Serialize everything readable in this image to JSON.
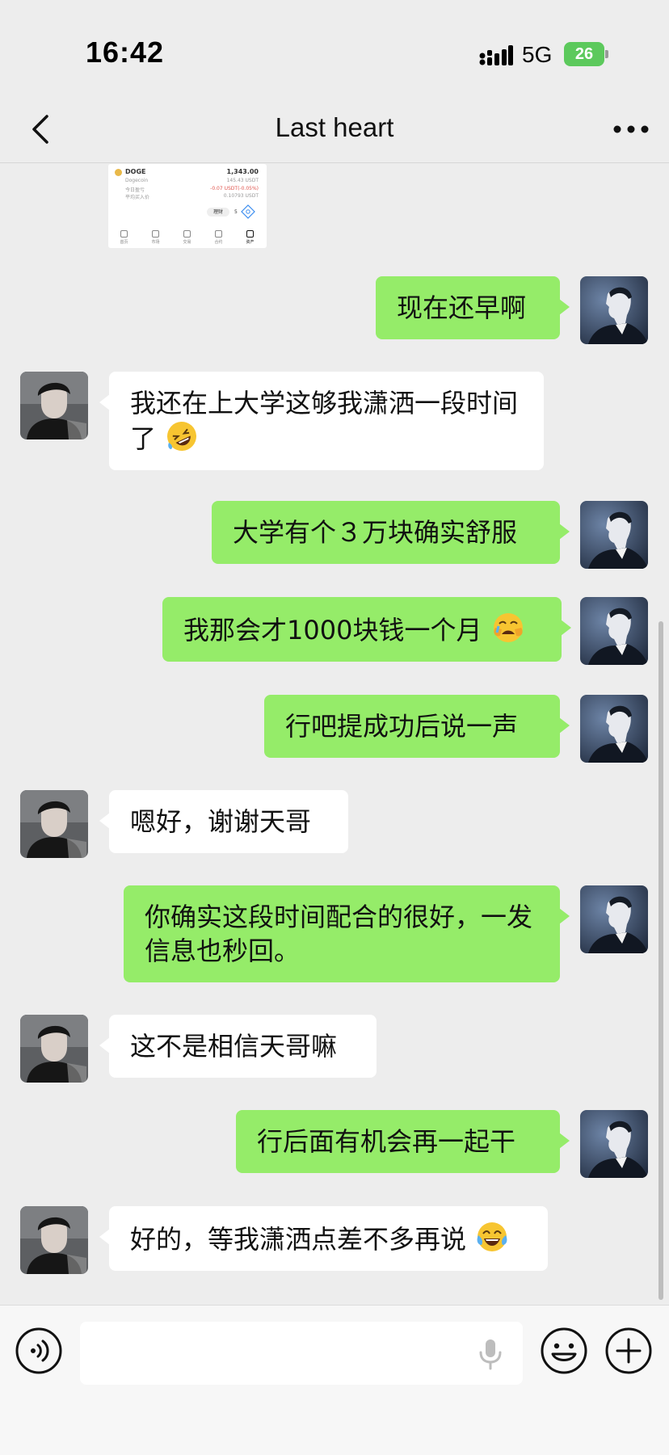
{
  "status_bar": {
    "time": "16:42",
    "network": "5G",
    "battery_level": "26",
    "battery_color": "#5cc95c"
  },
  "header": {
    "back_icon": "chevron-left-icon",
    "title": "Last heart",
    "more_icon": "more-icon"
  },
  "shared_image": {
    "coin": "DOGE",
    "coin_name": "Dogecoin",
    "amount": "1,343.00",
    "amount_usdt": "145.43 USDT",
    "pnl_label": "今日盈亏",
    "pnl_value": "-0.07 USDT(-0.05%)",
    "avg_label": "平均买入价",
    "avg_value": "0.10793 USDT",
    "action_label": "理财",
    "action_value": "5",
    "nav": [
      "首页",
      "市场",
      "交易",
      "合约",
      "资产"
    ]
  },
  "colors": {
    "sent_bubble": "#95ec69",
    "received_bubble": "#ffffff",
    "background": "#ededed"
  },
  "messages": [
    {
      "sender": "me",
      "text": "现在还早啊"
    },
    {
      "sender": "other",
      "text": "我还在上大学这够我潇洒一段时间了",
      "emoji": "rofl-emoji"
    },
    {
      "sender": "me",
      "text": "大学有个３万块确实舒服"
    },
    {
      "sender": "me",
      "text": "我那会才1000块钱一个月",
      "emoji": "crying-emoji"
    },
    {
      "sender": "me",
      "text": "行吧提成功后说一声"
    },
    {
      "sender": "other",
      "text": "嗯好，谢谢天哥"
    },
    {
      "sender": "me",
      "text": "你确实这段时间配合的很好，一发信息也秒回。"
    },
    {
      "sender": "other",
      "text": "这不是相信天哥嘛"
    },
    {
      "sender": "me",
      "text": "行后面有机会再一起干"
    },
    {
      "sender": "other",
      "text": "好的，等我潇洒点差不多再说",
      "emoji": "tears-of-joy-emoji"
    }
  ],
  "input_bar": {
    "voice_icon": "voice-icon",
    "mic_icon": "mic-icon",
    "emoji_icon": "emoji-icon",
    "plus_icon": "plus-icon"
  }
}
